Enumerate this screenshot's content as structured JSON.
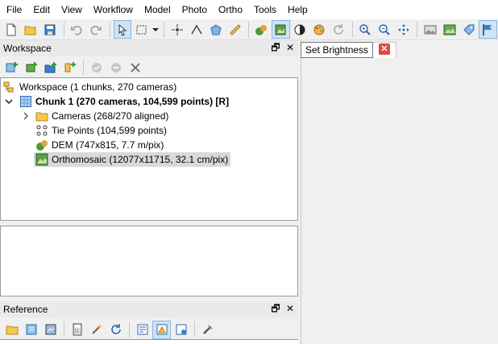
{
  "menu": [
    "File",
    "Edit",
    "View",
    "Workflow",
    "Model",
    "Photo",
    "Ortho",
    "Tools",
    "Help"
  ],
  "toolbar": {
    "tooltip": "Set Brightness"
  },
  "workspace": {
    "title": "Workspace",
    "root_label": "Workspace (1 chunks, 270 cameras)",
    "chunk_label": "Chunk 1 (270 cameras, 104,599 points) [R]",
    "items": [
      {
        "label": "Cameras (268/270 aligned)",
        "icon": "folder-icon"
      },
      {
        "label": "Tie Points (104,599 points)",
        "icon": "tie-points-icon"
      },
      {
        "label": "DEM (747x815, 7.7 m/pix)",
        "icon": "dem-icon"
      },
      {
        "label": "Orthomosaic (12077x11715, 32.1 cm/pix)",
        "icon": "orthomosaic-icon"
      }
    ],
    "panel_ctrl_float": "🗗",
    "panel_ctrl_close": "✕"
  },
  "reference": {
    "title": "Reference"
  },
  "tab_close": "✕",
  "colors": {
    "accent_active": "#cce4f7",
    "tab_close_red": "#e0473d",
    "selection": "#d9d9d9"
  }
}
